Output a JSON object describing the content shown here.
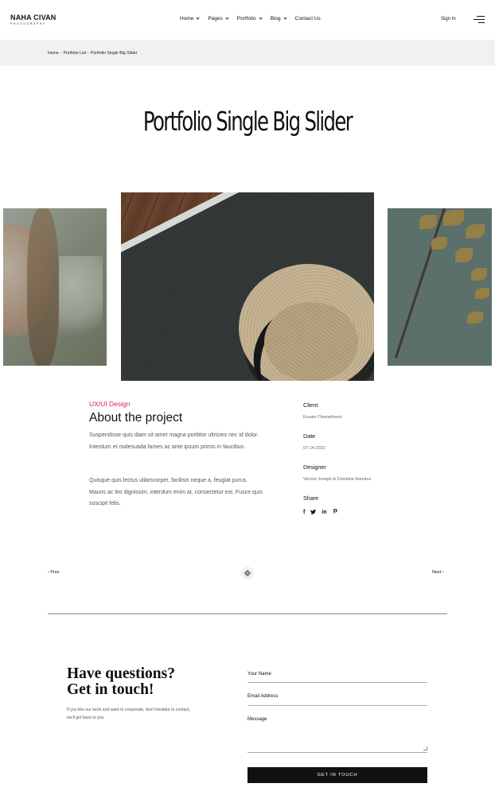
{
  "header": {
    "logo_main": "NAHA CIVAN",
    "logo_sub": "PHOTOGRAPHY",
    "nav": [
      {
        "label": "Home",
        "dropdown": true
      },
      {
        "label": "Pages",
        "dropdown": true
      },
      {
        "label": "Portfolio",
        "dropdown": true
      },
      {
        "label": "Blog",
        "dropdown": true
      },
      {
        "label": "Contact Us",
        "dropdown": false
      }
    ],
    "sign_in": "Sign In",
    "menu_icon": "hamburger-menu-icon"
  },
  "breadcrumb": {
    "items": [
      "Home",
      "Portfolio List",
      "Portfolio Single Big Slider"
    ],
    "separator": "-"
  },
  "page_title": "Portfolio Single Big Slider",
  "project": {
    "category": "UX/UI Design",
    "heading": "About the project",
    "paragraph_1": "Suspendisse quis diam sit amet magna porttitor ultricies nec id dolor. Interdum et malesuada fames ac ante ipsum primis in faucibus.",
    "paragraph_2": "Quisque quis lectus ullamcorper, facilisis neque a, feugiat purus. Mauris ac leo dignissim, interdum enim at, consectetur est. Fusce quis suscipit felis.",
    "meta": {
      "client_label": "Client",
      "client_value": "Envato Themeforest",
      "date_label": "Date",
      "date_value": "07-14-2022",
      "designer_label": "Designer",
      "designer_value": "Vernon Joseph & Christine Ramirez",
      "share_label": "Share"
    },
    "share_icons": [
      "facebook-icon",
      "twitter-icon",
      "linkedin-icon",
      "pinterest-icon"
    ],
    "accent_color": "#e0195c"
  },
  "pager": {
    "prev": "Prev",
    "next": "Next",
    "grid_icon": "grid-diamond-icon"
  },
  "contact": {
    "heading_line1": "Have questions?",
    "heading_line2": "Get in touch!",
    "text": "If you like our work and want to cooperate, don't hesitate to contact, we'll get back to you",
    "fields": {
      "name_label": "Your Name",
      "email_label": "Email Address",
      "message_label": "Message"
    },
    "submit": "GET IN TOUCH"
  }
}
